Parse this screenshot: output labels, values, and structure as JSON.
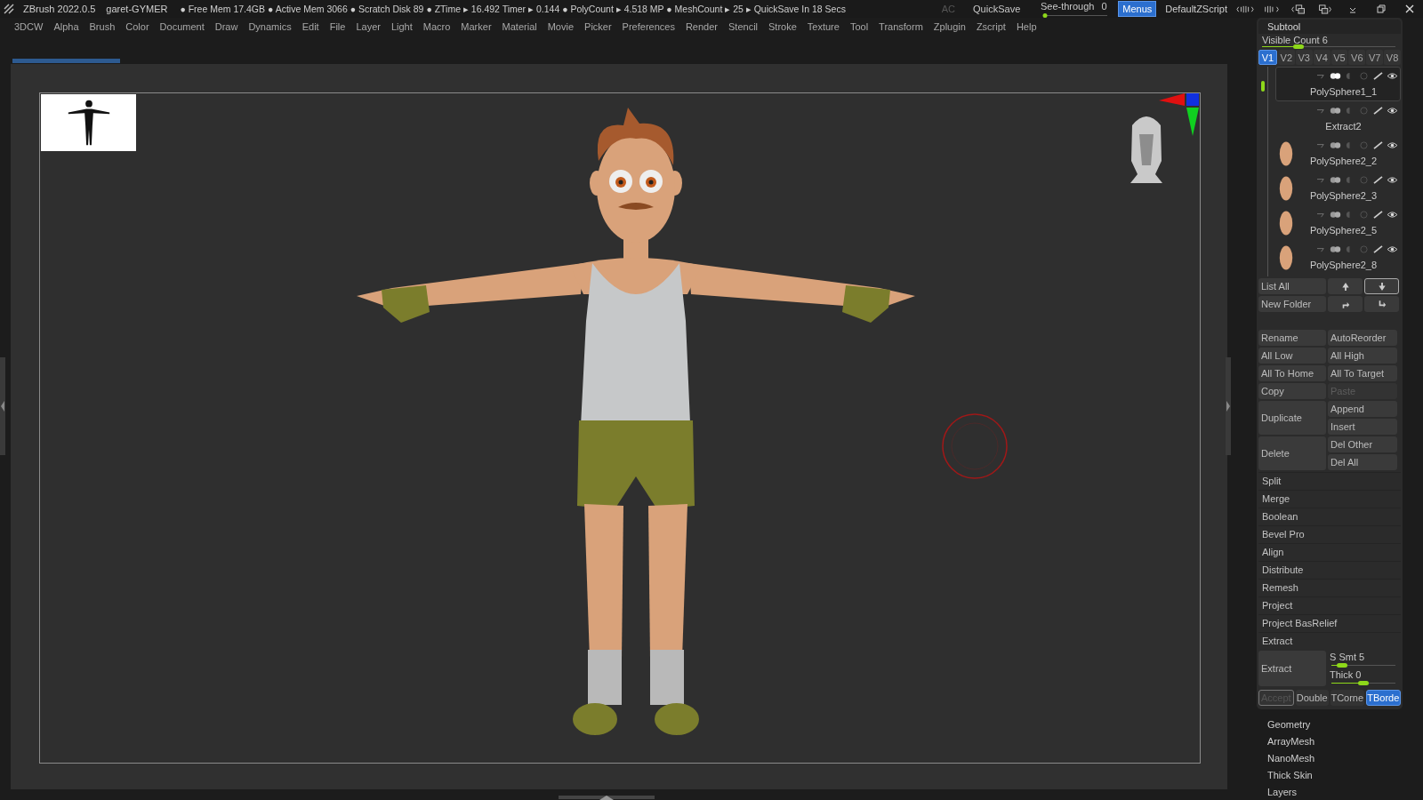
{
  "title_bar": {
    "app": "ZBrush 2022.0.5",
    "document": "garet-GYMER",
    "status": "● Free Mem 17.4GB ● Active Mem 3066 ● Scratch Disk 89 ● ZTime ▸ 16.492 Timer ▸ 0.144 ● PolyCount ▸ 4.518 MP ● MeshCount ▸ 25 ▸ QuickSave In 18 Secs",
    "ac": "AC",
    "quicksave": "QuickSave",
    "see_through": {
      "label": "See-through",
      "value": "0",
      "level": 0
    },
    "menus_button": {
      "label": "Menus",
      "on": true
    },
    "script": "DefaultZScript"
  },
  "menu_bar": [
    "3DCW",
    "Alpha",
    "Brush",
    "Color",
    "Document",
    "Draw",
    "Dynamics",
    "Edit",
    "File",
    "Layer",
    "Light",
    "Macro",
    "Marker",
    "Material",
    "Movie",
    "Picker",
    "Preferences",
    "Render",
    "Stencil",
    "Stroke",
    "Texture",
    "Tool",
    "Transform",
    "Zplugin",
    "Zscript",
    "Help"
  ],
  "progress": {
    "level": 0.09
  },
  "subtool": {
    "title": "Subtool",
    "visible_count": {
      "label": "Visible Count",
      "value": "6",
      "level": 0.25
    },
    "versions": [
      {
        "label": "V1",
        "selected": true
      },
      {
        "label": "V2",
        "selected": false
      },
      {
        "label": "V3",
        "selected": false
      },
      {
        "label": "V4",
        "selected": false
      },
      {
        "label": "V5",
        "selected": false
      },
      {
        "label": "V6",
        "selected": false
      },
      {
        "label": "V7",
        "selected": false
      },
      {
        "label": "V8",
        "selected": false
      }
    ],
    "items": [
      {
        "name": "PolySphere1_1",
        "selected": true,
        "thumbnail": false
      },
      {
        "name": "Extract2",
        "selected": false,
        "thumbnail": false
      },
      {
        "name": "PolySphere2_2",
        "selected": false,
        "thumbnail": true
      },
      {
        "name": "PolySphere2_3",
        "selected": false,
        "thumbnail": true
      },
      {
        "name": "PolySphere2_5",
        "selected": false,
        "thumbnail": true
      },
      {
        "name": "PolySphere2_8",
        "selected": false,
        "thumbnail": true
      }
    ],
    "list_all": "List All",
    "new_folder": "New Folder",
    "buttons": [
      {
        "label": "Rename",
        "disabled": false
      },
      {
        "label": "AutoReorder",
        "disabled": false
      },
      {
        "label": "All Low",
        "disabled": false
      },
      {
        "label": "All High",
        "disabled": false
      },
      {
        "label": "All To Home",
        "disabled": false
      },
      {
        "label": "All To Target",
        "disabled": false
      },
      {
        "label": "Copy",
        "disabled": false
      },
      {
        "label": "Paste",
        "disabled": true
      }
    ],
    "stacks": [
      {
        "label": "Duplicate",
        "options": [
          "Append",
          "Insert"
        ]
      },
      {
        "label": "Delete",
        "options": [
          "Del Other",
          "Del All"
        ]
      }
    ],
    "tools": [
      "Split",
      "Merge",
      "Boolean",
      "Bevel Pro",
      "Align",
      "Distribute",
      "Remesh",
      "Project",
      "Project BasRelief"
    ],
    "extract": {
      "title": "Extract",
      "button": "Extract",
      "sliders": [
        {
          "label": "S Smt",
          "value": "5",
          "level": 0.1
        },
        {
          "label": "Thick",
          "value": "0",
          "level": 0.5
        }
      ],
      "options": [
        {
          "label": "Accept",
          "disabled": true,
          "on": false
        },
        {
          "label": "Double",
          "disabled": false,
          "on": false
        },
        {
          "label": "TCorne",
          "disabled": false,
          "on": false
        },
        {
          "label": "TBorde",
          "disabled": false,
          "on": true
        }
      ]
    }
  },
  "subpalettes": [
    "Geometry",
    "ArrayMesh",
    "NanoMesh",
    "Thick Skin",
    "Layers"
  ]
}
